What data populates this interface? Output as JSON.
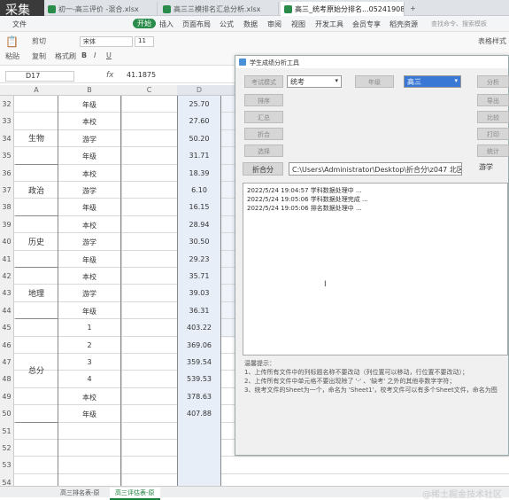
{
  "overlay_label": "采集",
  "file_tabs": [
    {
      "label": "初一-高三评价 -混合.xlsx",
      "active": false
    },
    {
      "label": "高三三模排名汇总分析.xlsx",
      "active": false
    },
    {
      "label": "高三_统考原始分排名...0524190836.xlsx",
      "active": true
    }
  ],
  "menu_items": [
    "文件",
    "开始",
    "插入",
    "页面布局",
    "公式",
    "数据",
    "审阅",
    "视图",
    "开发工具",
    "会员专享",
    "稻壳资源",
    "查找命令、搜索模板"
  ],
  "ribbon": {
    "paste": "粘贴",
    "cut": "剪切",
    "copy": "复制",
    "format_painter": "格式刷",
    "font": "宋体",
    "font_size": "11",
    "table_style": "表格样式",
    "bold": "B",
    "italic": "I",
    "underline": "U"
  },
  "formula_bar": {
    "cell": "D17",
    "fx": "fx",
    "value": "41.1875"
  },
  "columns": [
    "A",
    "B",
    "C",
    "D"
  ],
  "rows": [
    {
      "n": "32",
      "b": "年级",
      "d": "25.70"
    },
    {
      "n": "33",
      "b": "本校",
      "d": "27.60"
    },
    {
      "n": "34",
      "b": "游学",
      "d": "50.20"
    },
    {
      "n": "35",
      "b": "年级",
      "d": "31.71"
    },
    {
      "n": "36",
      "b": "本校",
      "d": "18.39"
    },
    {
      "n": "37",
      "b": "游学",
      "d": "6.10"
    },
    {
      "n": "38",
      "b": "年级",
      "d": "16.15"
    },
    {
      "n": "39",
      "b": "本校",
      "d": "28.94"
    },
    {
      "n": "40",
      "b": "游学",
      "d": "30.50"
    },
    {
      "n": "41",
      "b": "年级",
      "d": "29.23"
    },
    {
      "n": "42",
      "b": "本校",
      "d": "35.71"
    },
    {
      "n": "43",
      "b": "游学",
      "d": "39.03"
    },
    {
      "n": "44",
      "b": "年级",
      "d": "36.31"
    },
    {
      "n": "45",
      "b": "1",
      "d": "403.22"
    },
    {
      "n": "46",
      "b": "2",
      "d": "369.06"
    },
    {
      "n": "47",
      "b": "3",
      "d": "359.54"
    },
    {
      "n": "48",
      "b": "4",
      "d": "539.53"
    },
    {
      "n": "49",
      "b": "本校",
      "d": "378.63"
    },
    {
      "n": "50",
      "b": "年级",
      "d": "407.88"
    },
    {
      "n": "51",
      "b": "",
      "d": ""
    },
    {
      "n": "52",
      "b": "",
      "d": ""
    },
    {
      "n": "53",
      "b": "",
      "d": ""
    },
    {
      "n": "54",
      "b": "",
      "d": ""
    }
  ],
  "subjects": [
    "生物",
    "政治",
    "历史",
    "地理",
    "总分"
  ],
  "sheet_tabs": [
    "高三排名表-原",
    "高三评估表-原"
  ],
  "watermark": "@稀土掘金技术社区",
  "dialog": {
    "title": "学生成绩分析工具",
    "btn_left_1": "考试模式",
    "select_exam": "统考",
    "btn_mid": "年级",
    "select_grade": "高三",
    "btn_right_1": "分析",
    "btn_left_2": "排序",
    "btn_right_2": "导出",
    "btn_left_3": "汇总",
    "btn_right_3": "比较",
    "btn_left_4": "折合",
    "btn_right_4": "打印",
    "btn_left_5": "选择",
    "btn_right_5": "统计",
    "path_label": "折合分",
    "path_value": "C:\\Users\\Administrator\\Desktop\\折合分\\z047 北区",
    "kind_label": "游学",
    "log": [
      "2022/5/24 19:04:57 学科数据处理中 ...",
      "2022/5/24 19:05:06 学科数据处理完成 ...",
      "2022/5/24 19:05:06 排名数据处理中 ..."
    ],
    "hint_title": "温馨提示：",
    "hints": [
      "1、上传所有文件中的列标题名称不要改动（列位置可以移动，行位置不要改动）；",
      "2、上传所有文件中单元格不要出现除了 '-' 、'缺考' 之外的其他非数字字符；",
      "3、统考文件的Sheet为一个，命名为 'Sheet1'，校考文件可以有多个Sheet文件，命名为图"
    ]
  }
}
